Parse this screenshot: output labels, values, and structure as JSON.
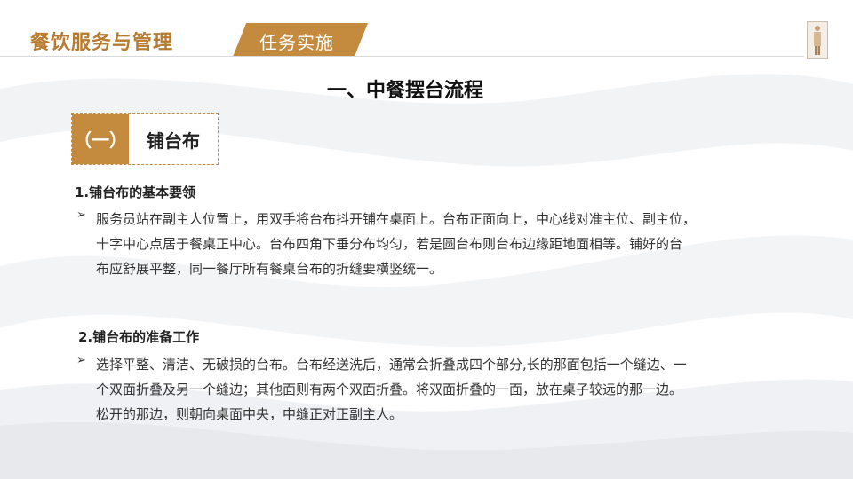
{
  "header": {
    "title": "餐饮服务与管理",
    "tab": "任务实施"
  },
  "section_title": "一、中餐摆台流程",
  "badge": {
    "number": "（一）",
    "label": "铺台布"
  },
  "blocks": [
    {
      "heading": "1.铺台布的基本要领",
      "lines": [
        "服务员站在副主人位置上，用双手将台布抖开铺在桌面上。台布正面向上，中心线对准主位、副主位，",
        "十字中心点居于餐桌正中心。台布四角下垂分布均匀，若是圆台布则台布边缘距地面相等。铺好的台",
        "布应舒展平整，同一餐厅所有餐桌台布的折缝要横竖统一。"
      ]
    },
    {
      "heading": "2.铺台布的准备工作",
      "lines": [
        "选择平整、清洁、无破损的台布。台布经送洗后，通常会折叠成四个部分,长的那面包括一个缝边、一",
        "个双面折叠及另一个缝边；其他面则有两个双面折叠。将双面折叠的一面，放在桌子较远的那一边。",
        "松开的那边，则朝向桌面中央，中缝正对正副主人。"
      ]
    }
  ],
  "icons": {
    "bullet": "arrow-bullet-icon"
  },
  "colors": {
    "accent": "#c48a3e",
    "title_text": "#b87a2e"
  }
}
